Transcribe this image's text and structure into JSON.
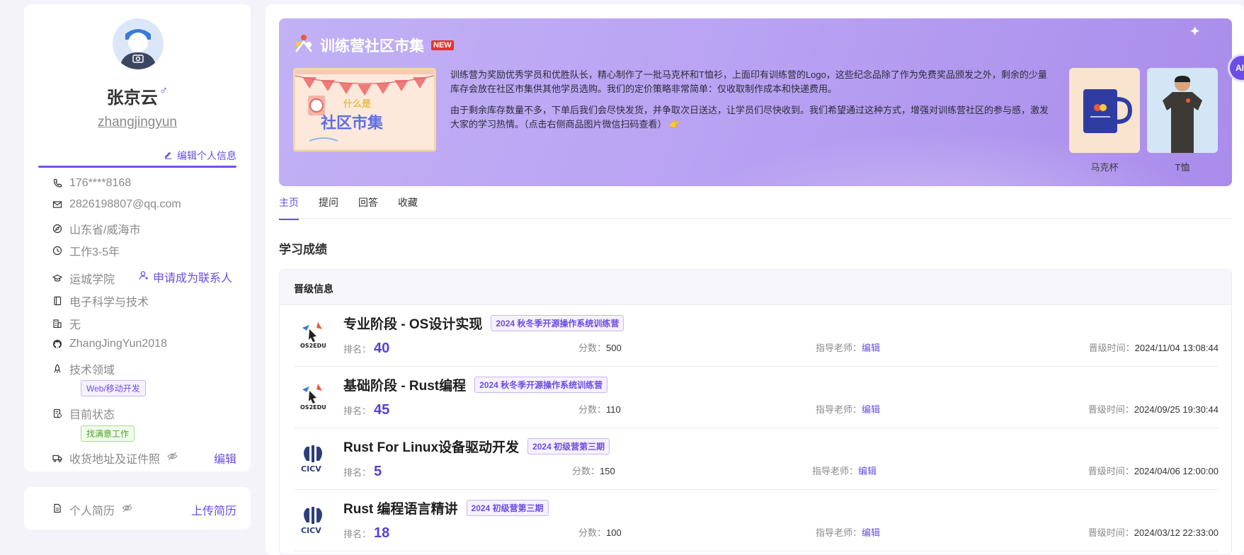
{
  "profile": {
    "name": "张京云",
    "gender_symbol": "♂",
    "username": "zhangjingyun",
    "edit_label": "编辑个人信息",
    "phone": "176****8168",
    "email": "2826198807@qq.com",
    "location": "山东省/威海市",
    "experience": "工作3-5年",
    "school": "运城学院",
    "apply_contact_label": "申请成为联系人",
    "major": "电子科学与技术",
    "company": "无",
    "github": "ZhangJingYun2018",
    "tech_field_label": "技术领域",
    "tech_field_tag": "Web/移动开发",
    "status_label": "目前状态",
    "status_tag": "找满意工作",
    "address_label": "收货地址及证件照",
    "address_edit": "编辑",
    "resume_label": "个人简历",
    "resume_upload": "上传简历"
  },
  "banner": {
    "title": "训练营社区市集",
    "badge": "NEW",
    "poster_line1": "什么是",
    "poster_line2": "社区市集",
    "paragraph1": "训练营为奖励优秀学员和优胜队长，精心制作了一批马克杯和T恤衫，上面印有训练营的Logo，这些纪念品除了作为免费奖品颁发之外，剩余的少量库存会放在社区市集供其他学员选购。我们的定价策略非常简单：仅收取制作成本和快递费用。",
    "paragraph2": "由于剩余库存数量不多，下单后我们会尽快发货，并争取次日送达，让学员们尽快收到。我们希望通过这种方式，增强对训练营社区的参与感，激发大家的学习热情。（点击右侧商品图片微信扫码查看）",
    "product1": "马克杯",
    "product2": "T恤"
  },
  "ai_bubble": "AI",
  "tabs": [
    "主页",
    "提问",
    "回答",
    "收藏"
  ],
  "section_title": "学习成绩",
  "promotion": {
    "header": "晋级信息",
    "rank_label": "排名：",
    "score_label": "分数：",
    "teacher_label": "指导老师：",
    "time_label": "晋级时间：",
    "records": [
      {
        "logo": "os2edu",
        "title": "专业阶段 - OS设计实现",
        "tag": "2024 秋冬季开源操作系统训练营",
        "rank": "40",
        "score": "500",
        "teacher": "编辑",
        "time": "2024/11/04 13:08:44"
      },
      {
        "logo": "os2edu",
        "title": "基础阶段 - Rust编程",
        "tag": "2024 秋冬季开源操作系统训练营",
        "rank": "45",
        "score": "110",
        "teacher": "编辑",
        "time": "2024/09/25 19:30:44"
      },
      {
        "logo": "cicv",
        "title": "Rust For Linux设备驱动开发",
        "tag": "2024 初级营第三期",
        "rank": "5",
        "score": "150",
        "teacher": "编辑",
        "time": "2024/04/06 12:00:00"
      },
      {
        "logo": "cicv",
        "title": "Rust 编程语言精讲",
        "tag": "2024 初级营第三期",
        "rank": "18",
        "score": "100",
        "teacher": "编辑",
        "time": "2024/03/12 22:33:00"
      }
    ]
  }
}
